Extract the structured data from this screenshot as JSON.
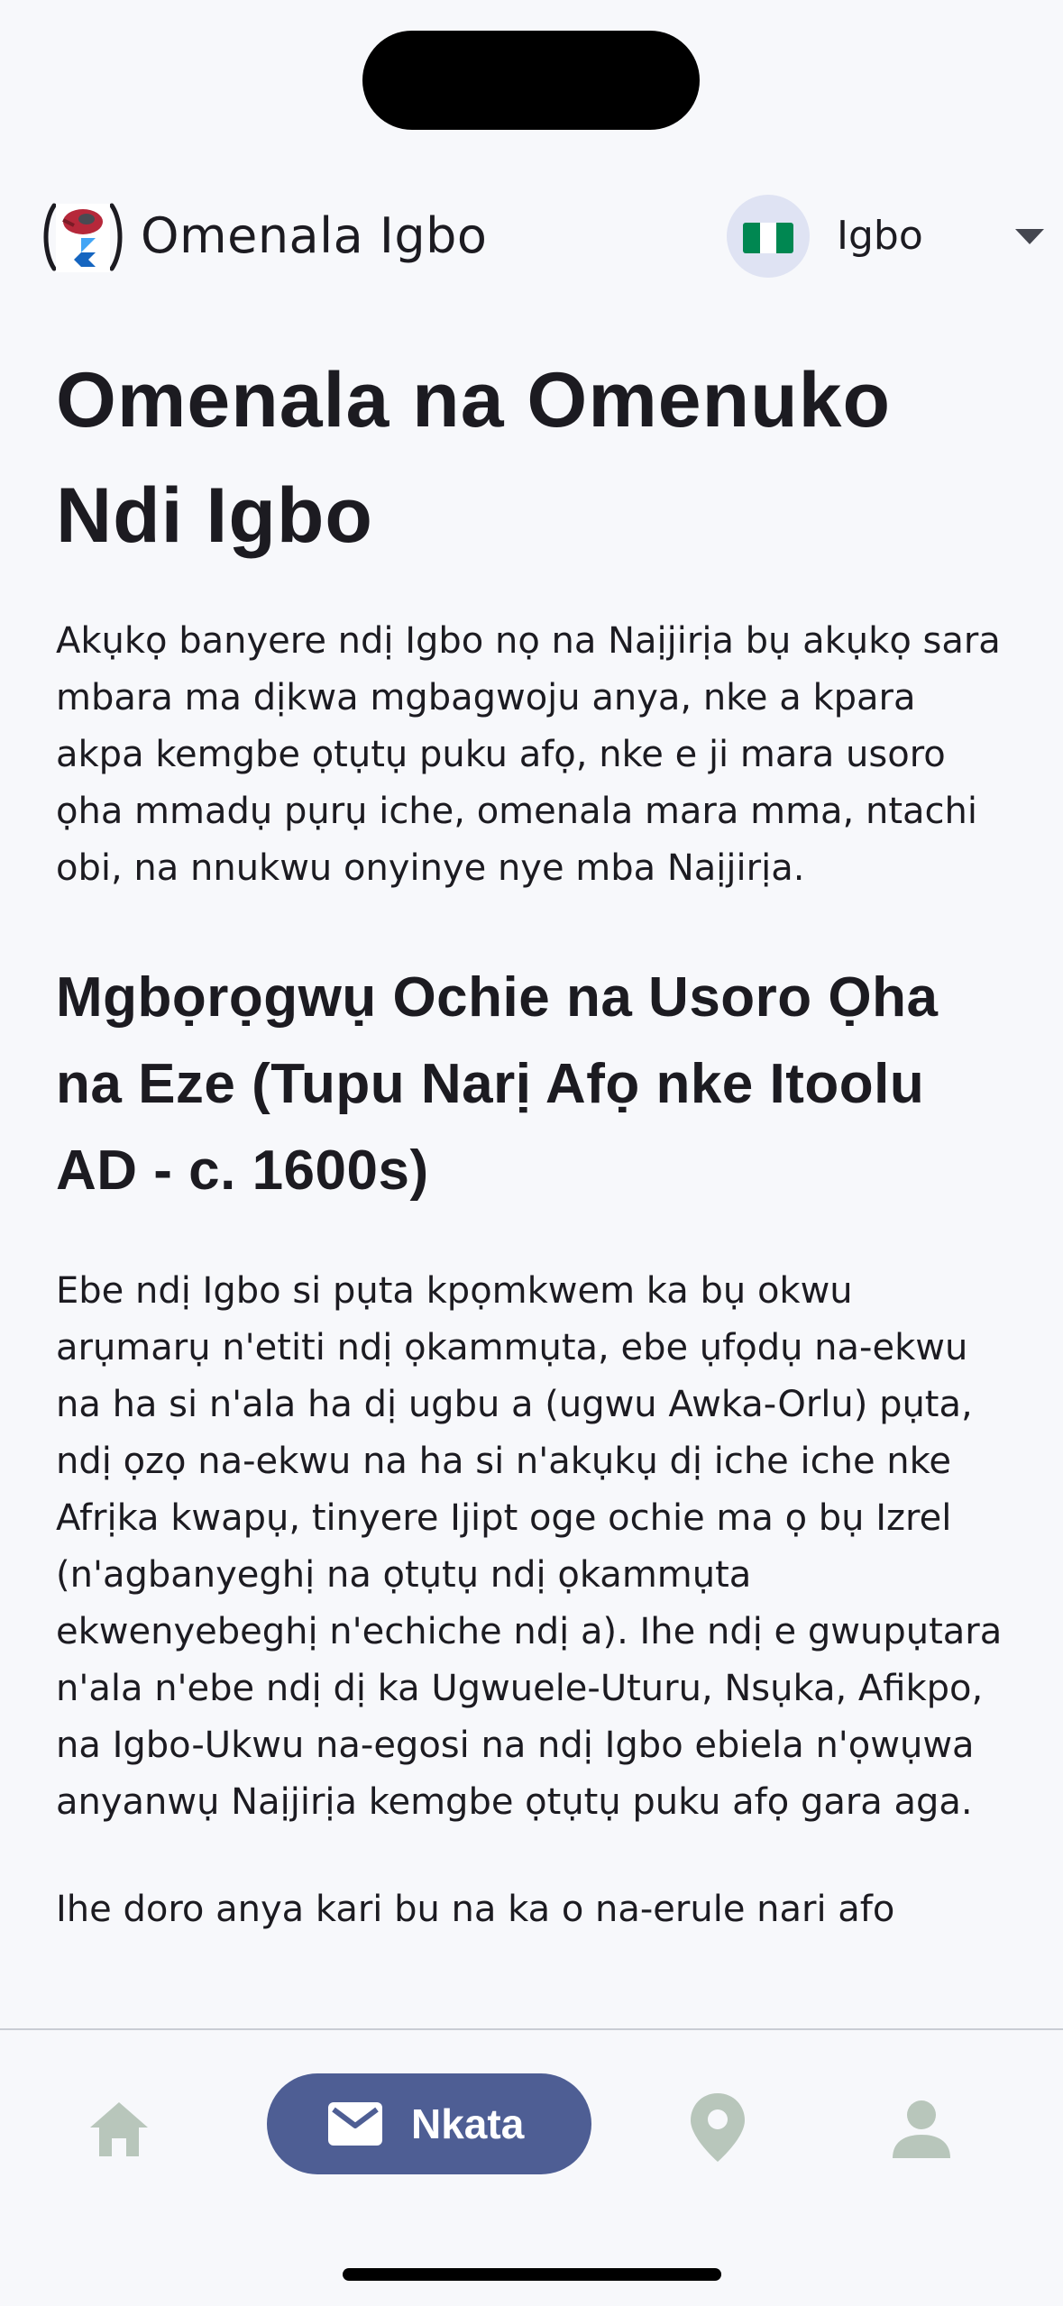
{
  "app_bar": {
    "title": "Omenala Igbo",
    "logo_icon": "app-logo-icon",
    "language": {
      "label": "Igbo",
      "flag_icon": "nigeria-flag-icon",
      "flag_colors": [
        "#008751",
        "#ffffff",
        "#008751"
      ],
      "caret_icon": "dropdown-caret-icon"
    }
  },
  "article": {
    "title": "Omenala na Omenuko Ndi Igbo",
    "intro": "Akụkọ banyere ndị Igbo nọ na Naịjirịa bụ akụkọ sara mbara ma dịkwa mgbagwoju anya, nke a kpara akpa kemgbe ọtụtụ puku afọ, nke e ji mara usoro ọha mmadụ pụrụ iche, omenala mara mma, ntachi obi, na nnukwu onyinye nye mba Naịjirịa.",
    "section_title": "Mgbọrọgwụ Ochie na Usoro Ọha na Eze (Tupu Narị Afọ nke Itoolu AD - c. 1600s)",
    "section_body": "Ebe ndị Igbo si pụta kpọmkwem ka bụ okwu arụmarụ n'etiti ndị ọkammụta, ebe ụfọdụ na-ekwu na ha si n'ala ha dị ugbu a (ugwu Awka-Orlu) pụta, ndị ọzọ na-ekwu na ha si n'akụkụ dị iche iche nke Afrịka kwapụ, tinyere Ijipt oge ochie ma ọ bụ Izrel (n'agbanyeghị na ọtụtụ ndị ọkammụta ekwenyebeghị n'echiche ndị a). Ihe ndị e gwupụtara n'ala n'ebe ndị dị ka Ugwuele-Uturu, Nsụka, Afikpo, na Igbo-Ukwu na-egosi na ndị Igbo ebiela n'ọwụwa anyanwụ Naịjirịa kemgbe ọtụtụ puku afọ gara aga.",
    "partial_next": "Ihe doro anya kari bu na ka o na-erule nari afo"
  },
  "bottom_nav": {
    "items": [
      {
        "icon": "home-icon",
        "label": ""
      },
      {
        "icon": "mail-icon",
        "label": "Nkata"
      },
      {
        "icon": "location-pin-icon",
        "label": ""
      },
      {
        "icon": "person-icon",
        "label": ""
      }
    ],
    "active_index": 1,
    "active_color": "#4e5e94",
    "inactive_color": "#b8c6bb"
  }
}
